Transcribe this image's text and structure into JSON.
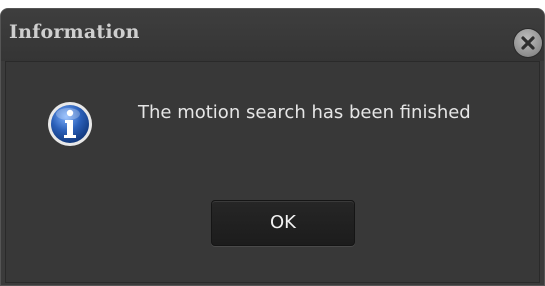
{
  "dialog": {
    "title": "Information",
    "message": "The motion search has been finished",
    "ok_label": "OK",
    "icons": {
      "info": "info-icon",
      "close": "close-icon"
    },
    "colors": {
      "background": "#3b3b3b",
      "title_text": "#cfcfcf",
      "message_text": "#e6e6e6",
      "button_background": "#1f1f1f",
      "info_icon_blue": "#2a5fb8"
    }
  }
}
